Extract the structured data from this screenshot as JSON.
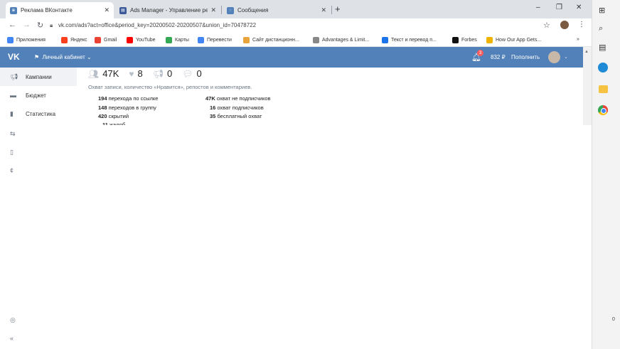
{
  "browser": {
    "tabs": [
      {
        "title": "Реклама ВКонтакте",
        "active": true
      },
      {
        "title": "Ads Manager - Управление рек",
        "active": false
      },
      {
        "title": "Сообщения",
        "active": false
      }
    ],
    "new_tab": "+",
    "window": {
      "minimize": "–",
      "restore": "❐",
      "close": "✕"
    },
    "url": "vk.com/ads?act=office&period_key=20200502-20200507&union_id=70478722",
    "bookmarks": [
      {
        "label": "Приложения",
        "color": "#4285f4"
      },
      {
        "label": "Яндекс",
        "color": "#fc3f1d"
      },
      {
        "label": "Gmail",
        "color": "#ea4335"
      },
      {
        "label": "YouTube",
        "color": "#ff0000"
      },
      {
        "label": "Карты",
        "color": "#34a853"
      },
      {
        "label": "Перевести",
        "color": "#4285f4"
      },
      {
        "label": "Сайт дистанционн...",
        "color": "#e8a33d"
      },
      {
        "label": "Advantages & Limit...",
        "color": "#888888"
      },
      {
        "label": "Текст и перевод п...",
        "color": "#1a73e8"
      },
      {
        "label": "Forbes",
        "color": "#111111"
      },
      {
        "label": "How Our App Gets...",
        "color": "#f0b400"
      }
    ],
    "bookmarks_more": "»"
  },
  "vk": {
    "logo": "VK",
    "menu_label": "Личный кабинет",
    "notifications": "3",
    "balance": "832 ₽",
    "topup": "Пополнить",
    "accent": "#5181b8"
  },
  "sidebar": {
    "items": [
      {
        "label": "Кампании",
        "icon": "megaphone-icon",
        "active": true
      },
      {
        "label": "Бюджет",
        "icon": "wallet-icon",
        "active": false
      },
      {
        "label": "Статистика",
        "icon": "chart-icon",
        "active": false
      }
    ],
    "collapse": "«"
  },
  "content": {
    "stats": {
      "reach": "47K",
      "likes": "8",
      "shares": "0",
      "comments": "0"
    },
    "description": "Охват записи, количество «Нравится», репостов и комментариев.",
    "left_metrics": [
      {
        "value": "194",
        "label": "перехода по ссылке"
      },
      {
        "value": "148",
        "label": "переходов в группу"
      },
      {
        "value": "420",
        "label": "скрытий"
      },
      {
        "value": "11",
        "label": "жалоб"
      }
    ],
    "right_metrics": [
      {
        "value": "47K",
        "label": "охват не подписчиков"
      },
      {
        "value": "16",
        "label": "охват подписчиков"
      },
      {
        "value": "35",
        "label": "бесплатный охват"
      }
    ]
  },
  "taskbar": {
    "badge": "0"
  }
}
